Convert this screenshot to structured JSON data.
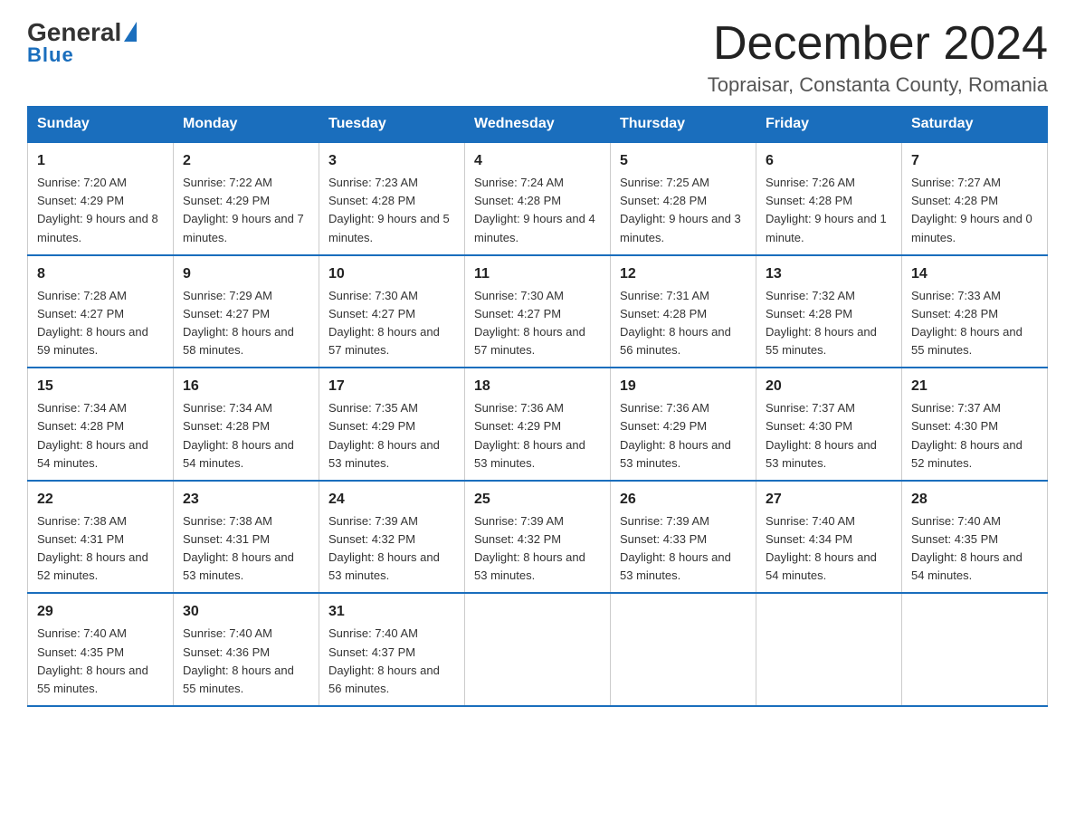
{
  "logo": {
    "general": "General",
    "blue": "Blue",
    "line2": "Blue"
  },
  "header": {
    "month": "December 2024",
    "location": "Topraisar, Constanta County, Romania"
  },
  "weekdays": [
    "Sunday",
    "Monday",
    "Tuesday",
    "Wednesday",
    "Thursday",
    "Friday",
    "Saturday"
  ],
  "weeks": [
    [
      {
        "day": "1",
        "sunrise": "7:20 AM",
        "sunset": "4:29 PM",
        "daylight": "9 hours and 8 minutes."
      },
      {
        "day": "2",
        "sunrise": "7:22 AM",
        "sunset": "4:29 PM",
        "daylight": "9 hours and 7 minutes."
      },
      {
        "day": "3",
        "sunrise": "7:23 AM",
        "sunset": "4:28 PM",
        "daylight": "9 hours and 5 minutes."
      },
      {
        "day": "4",
        "sunrise": "7:24 AM",
        "sunset": "4:28 PM",
        "daylight": "9 hours and 4 minutes."
      },
      {
        "day": "5",
        "sunrise": "7:25 AM",
        "sunset": "4:28 PM",
        "daylight": "9 hours and 3 minutes."
      },
      {
        "day": "6",
        "sunrise": "7:26 AM",
        "sunset": "4:28 PM",
        "daylight": "9 hours and 1 minute."
      },
      {
        "day": "7",
        "sunrise": "7:27 AM",
        "sunset": "4:28 PM",
        "daylight": "9 hours and 0 minutes."
      }
    ],
    [
      {
        "day": "8",
        "sunrise": "7:28 AM",
        "sunset": "4:27 PM",
        "daylight": "8 hours and 59 minutes."
      },
      {
        "day": "9",
        "sunrise": "7:29 AM",
        "sunset": "4:27 PM",
        "daylight": "8 hours and 58 minutes."
      },
      {
        "day": "10",
        "sunrise": "7:30 AM",
        "sunset": "4:27 PM",
        "daylight": "8 hours and 57 minutes."
      },
      {
        "day": "11",
        "sunrise": "7:30 AM",
        "sunset": "4:27 PM",
        "daylight": "8 hours and 57 minutes."
      },
      {
        "day": "12",
        "sunrise": "7:31 AM",
        "sunset": "4:28 PM",
        "daylight": "8 hours and 56 minutes."
      },
      {
        "day": "13",
        "sunrise": "7:32 AM",
        "sunset": "4:28 PM",
        "daylight": "8 hours and 55 minutes."
      },
      {
        "day": "14",
        "sunrise": "7:33 AM",
        "sunset": "4:28 PM",
        "daylight": "8 hours and 55 minutes."
      }
    ],
    [
      {
        "day": "15",
        "sunrise": "7:34 AM",
        "sunset": "4:28 PM",
        "daylight": "8 hours and 54 minutes."
      },
      {
        "day": "16",
        "sunrise": "7:34 AM",
        "sunset": "4:28 PM",
        "daylight": "8 hours and 54 minutes."
      },
      {
        "day": "17",
        "sunrise": "7:35 AM",
        "sunset": "4:29 PM",
        "daylight": "8 hours and 53 minutes."
      },
      {
        "day": "18",
        "sunrise": "7:36 AM",
        "sunset": "4:29 PM",
        "daylight": "8 hours and 53 minutes."
      },
      {
        "day": "19",
        "sunrise": "7:36 AM",
        "sunset": "4:29 PM",
        "daylight": "8 hours and 53 minutes."
      },
      {
        "day": "20",
        "sunrise": "7:37 AM",
        "sunset": "4:30 PM",
        "daylight": "8 hours and 53 minutes."
      },
      {
        "day": "21",
        "sunrise": "7:37 AM",
        "sunset": "4:30 PM",
        "daylight": "8 hours and 52 minutes."
      }
    ],
    [
      {
        "day": "22",
        "sunrise": "7:38 AM",
        "sunset": "4:31 PM",
        "daylight": "8 hours and 52 minutes."
      },
      {
        "day": "23",
        "sunrise": "7:38 AM",
        "sunset": "4:31 PM",
        "daylight": "8 hours and 53 minutes."
      },
      {
        "day": "24",
        "sunrise": "7:39 AM",
        "sunset": "4:32 PM",
        "daylight": "8 hours and 53 minutes."
      },
      {
        "day": "25",
        "sunrise": "7:39 AM",
        "sunset": "4:32 PM",
        "daylight": "8 hours and 53 minutes."
      },
      {
        "day": "26",
        "sunrise": "7:39 AM",
        "sunset": "4:33 PM",
        "daylight": "8 hours and 53 minutes."
      },
      {
        "day": "27",
        "sunrise": "7:40 AM",
        "sunset": "4:34 PM",
        "daylight": "8 hours and 54 minutes."
      },
      {
        "day": "28",
        "sunrise": "7:40 AM",
        "sunset": "4:35 PM",
        "daylight": "8 hours and 54 minutes."
      }
    ],
    [
      {
        "day": "29",
        "sunrise": "7:40 AM",
        "sunset": "4:35 PM",
        "daylight": "8 hours and 55 minutes."
      },
      {
        "day": "30",
        "sunrise": "7:40 AM",
        "sunset": "4:36 PM",
        "daylight": "8 hours and 55 minutes."
      },
      {
        "day": "31",
        "sunrise": "7:40 AM",
        "sunset": "4:37 PM",
        "daylight": "8 hours and 56 minutes."
      },
      null,
      null,
      null,
      null
    ]
  ]
}
